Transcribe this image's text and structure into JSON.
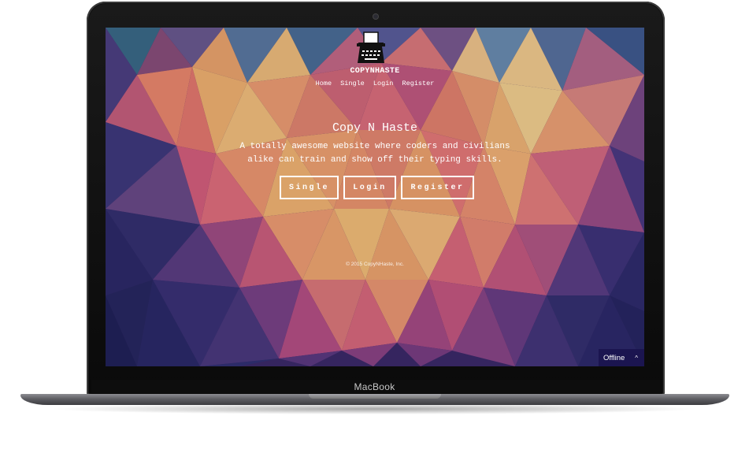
{
  "device": {
    "brand_label": "MacBook"
  },
  "site": {
    "brand_name": "COPYNHASTE",
    "nav": [
      "Home",
      "Single",
      "Login",
      "Register"
    ],
    "hero": {
      "title": "Copy N Haste",
      "text": "A totally awesome website where coders and civilians alike can train and show off their typing skills."
    },
    "buttons": {
      "single": "Single",
      "login": "Login",
      "register": "Register"
    },
    "footer": "© 2015 CopyNHaste, Inc."
  },
  "status": {
    "label": "Offline",
    "chevron": "^"
  },
  "icons": {
    "logo": "typewriter-icon",
    "status_chevron": "chevron-up-icon"
  },
  "colors": {
    "screen_base": "#3b2a66",
    "status_bg": "#1b1550",
    "button_border": "#ffffff",
    "text": "#ffffff"
  }
}
